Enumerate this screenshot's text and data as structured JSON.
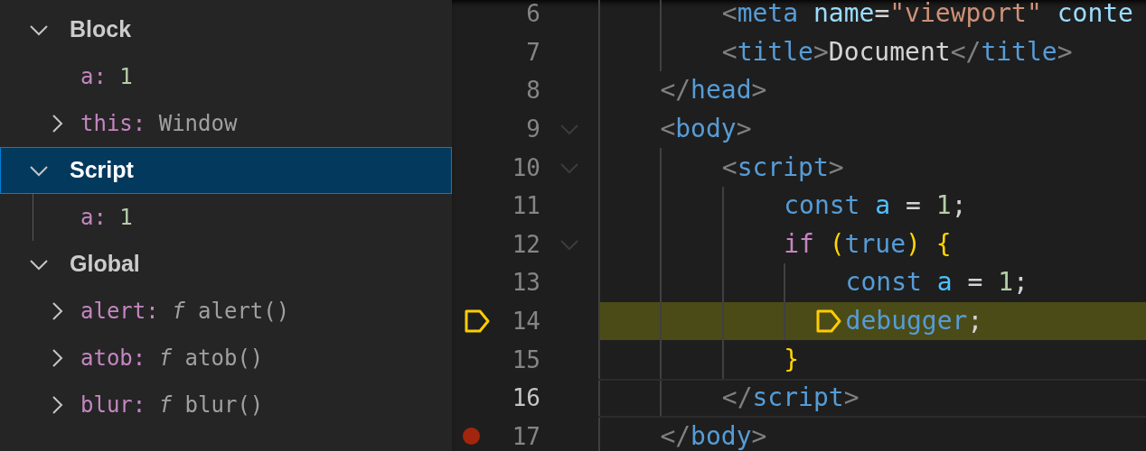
{
  "variables": {
    "scopes": [
      {
        "label": "Block",
        "expanded": true,
        "selected": false,
        "children": [
          {
            "name": "a:",
            "value": "1",
            "kind": "number"
          },
          {
            "name": "this:",
            "value": "Window",
            "kind": "object",
            "expanded": false
          }
        ]
      },
      {
        "label": "Script",
        "expanded": true,
        "selected": true,
        "children": [
          {
            "name": "a:",
            "value": "1",
            "kind": "number"
          }
        ]
      },
      {
        "label": "Global",
        "expanded": true,
        "selected": false,
        "children": [
          {
            "name": "alert:",
            "value": "*f* alert()",
            "kind": "function",
            "expanded": false
          },
          {
            "name": "atob:",
            "value": "*f* atob()",
            "kind": "function",
            "expanded": false
          },
          {
            "name": "blur:",
            "value": "*f* blur()",
            "kind": "function",
            "expanded": false
          }
        ]
      }
    ]
  },
  "editor": {
    "lines": [
      {
        "children": [
          {
            "children": [
              {
                "number": "6",
                "foldable": false,
                "paused": false,
                "cursor": false,
                "breakpoint": false,
                "tokens": [
                  {
                    "text": "<",
                    "kind": "punct"
                  },
                  {
                    "text": "meta ",
                    "kind": "tag"
                  },
                  {
                    "text": "name",
                    "kind": "attr"
                  },
                  {
                    "text": "=",
                    "kind": "text"
                  },
                  {
                    "text": "\"viewport\" ",
                    "kind": "string"
                  },
                  {
                    "text": "conte",
                    "kind": "attr"
                  }
                ]
              },
              {
                "number": "7",
                "foldable": false,
                "paused": false,
                "cursor": false,
                "breakpoint": false,
                "tokens": [
                  {
                    "text": "<",
                    "kind": "punct"
                  },
                  {
                    "text": "title",
                    "kind": "tag"
                  },
                  {
                    "text": ">",
                    "kind": "punct"
                  },
                  {
                    "text": "Document",
                    "kind": "text"
                  },
                  {
                    "text": "</",
                    "kind": "punct"
                  },
                  {
                    "text": "title",
                    "kind": "tag"
                  },
                  {
                    "text": ">",
                    "kind": "punct"
                  }
                ]
              }
            ]
          },
          {
            "number": "8",
            "foldable": false,
            "paused": false,
            "cursor": false,
            "breakpoint": false,
            "tokens": [
              {
                "text": "</",
                "kind": "punct"
              },
              {
                "text": "head",
                "kind": "tag"
              },
              {
                "text": ">",
                "kind": "punct"
              }
            ]
          },
          {
            "number": "9",
            "foldable": true,
            "paused": false,
            "cursor": false,
            "breakpoint": false,
            "tokens": [
              {
                "text": "<",
                "kind": "punct"
              },
              {
                "text": "body",
                "kind": "tag"
              },
              {
                "text": ">",
                "kind": "punct"
              }
            ],
            "children": [
              {
                "number": "10",
                "foldable": true,
                "paused": false,
                "cursor": false,
                "breakpoint": false,
                "tokens": [
                  {
                    "text": "<",
                    "kind": "punct"
                  },
                  {
                    "text": "script",
                    "kind": "tag"
                  },
                  {
                    "text": ">",
                    "kind": "punct"
                  }
                ],
                "children": [
                  {
                    "number": "11",
                    "foldable": false,
                    "paused": false,
                    "cursor": false,
                    "breakpoint": false,
                    "tokens": [
                      {
                        "text": "const ",
                        "kind": "storage"
                      },
                      {
                        "text": "a",
                        "kind": "variable"
                      },
                      {
                        "text": " = ",
                        "kind": "text"
                      },
                      {
                        "text": "1",
                        "kind": "number"
                      },
                      {
                        "text": ";",
                        "kind": "text"
                      }
                    ]
                  },
                  {
                    "number": "12",
                    "foldable": true,
                    "paused": false,
                    "cursor": false,
                    "breakpoint": false,
                    "tokens": [
                      {
                        "text": "if ",
                        "kind": "control"
                      },
                      {
                        "text": "(",
                        "kind": "bracket"
                      },
                      {
                        "text": "true",
                        "kind": "storage"
                      },
                      {
                        "text": ")",
                        "kind": "bracket"
                      },
                      {
                        "text": " {",
                        "kind": "bracket"
                      }
                    ],
                    "children": [
                      {
                        "number": "13",
                        "foldable": false,
                        "paused": false,
                        "cursor": false,
                        "breakpoint": false,
                        "tokens": [
                          {
                            "text": "const ",
                            "kind": "storage"
                          },
                          {
                            "text": "a",
                            "kind": "variable"
                          },
                          {
                            "text": " = ",
                            "kind": "text"
                          },
                          {
                            "text": "1",
                            "kind": "number"
                          },
                          {
                            "text": ";",
                            "kind": "text"
                          }
                        ]
                      },
                      {
                        "number": "14",
                        "foldable": false,
                        "paused": true,
                        "cursor": false,
                        "breakpoint": false,
                        "tokens": [
                          {
                            "text": "debugger",
                            "kind": "storage"
                          },
                          {
                            "text": ";",
                            "kind": "text"
                          }
                        ]
                      }
                    ]
                  },
                  {
                    "number": "15",
                    "foldable": false,
                    "paused": false,
                    "cursor": false,
                    "breakpoint": false,
                    "tokens": [
                      {
                        "text": "}",
                        "kind": "bracket"
                      }
                    ]
                  }
                ]
              },
              {
                "number": "16",
                "foldable": false,
                "paused": false,
                "cursor": true,
                "breakpoint": false,
                "tokens": [
                  {
                    "text": "</",
                    "kind": "punct"
                  },
                  {
                    "text": "script",
                    "kind": "tag"
                  },
                  {
                    "text": ">",
                    "kind": "punct"
                  }
                ]
              }
            ]
          },
          {
            "number": "17",
            "foldable": false,
            "paused": false,
            "cursor": false,
            "breakpoint": true,
            "tokens": [
              {
                "text": "</",
                "kind": "punct"
              },
              {
                "text": "body",
                "kind": "tag"
              },
              {
                "text": ">",
                "kind": "punct"
              }
            ]
          }
        ]
      }
    ]
  }
}
